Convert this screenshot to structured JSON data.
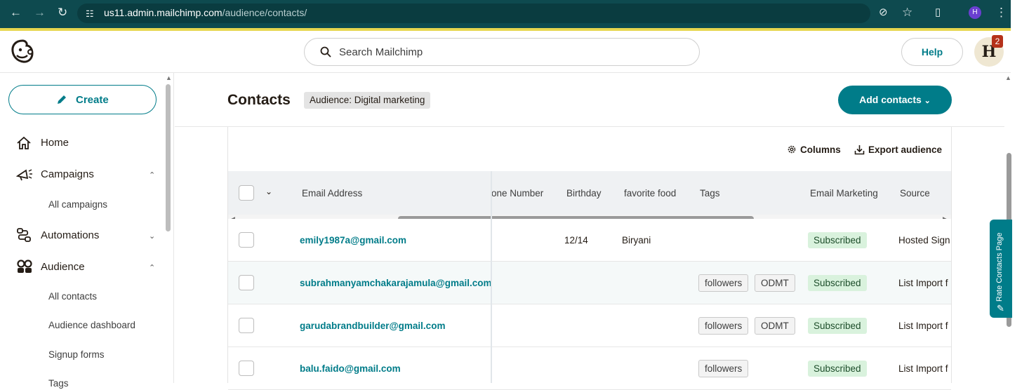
{
  "browser": {
    "url_host": "us11.admin.mailchimp.com",
    "url_path": "/audience/contacts/",
    "profile_initial": "H"
  },
  "header": {
    "search_placeholder": "Search Mailchimp",
    "help_label": "Help",
    "avatar_initial": "H",
    "notification_count": "2"
  },
  "sidebar": {
    "create_label": "Create",
    "home_label": "Home",
    "campaigns_label": "Campaigns",
    "all_campaigns_label": "All campaigns",
    "automations_label": "Automations",
    "audience_label": "Audience",
    "audience_items": [
      "All contacts",
      "Audience dashboard",
      "Signup forms",
      "Tags"
    ]
  },
  "page": {
    "title": "Contacts",
    "audience_badge": "Audience: Digital marketing",
    "add_contacts_label": "Add contacts",
    "columns_label": "Columns",
    "export_label": "Export audience",
    "rate_tab_label": "Rate Contacts Page"
  },
  "table": {
    "headers": [
      "Email Address",
      "one Number",
      "Birthday",
      "favorite food",
      "Tags",
      "Email Marketing",
      "Source"
    ],
    "rows": [
      {
        "email": "emily1987a@gmail.com",
        "birthday": "12/14",
        "food": "Biryani",
        "tags": [],
        "status": "Subscribed",
        "source": "Hosted Sign"
      },
      {
        "email": "subrahmanyamchakarajamula@gmail.com",
        "birthday": "",
        "food": "",
        "tags": [
          "followers",
          "ODMT"
        ],
        "status": "Subscribed",
        "source": "List Import f"
      },
      {
        "email": "garudabrandbuilder@gmail.com",
        "birthday": "",
        "food": "",
        "tags": [
          "followers",
          "ODMT"
        ],
        "status": "Subscribed",
        "source": "List Import f"
      },
      {
        "email": "balu.faido@gmail.com",
        "birthday": "",
        "food": "",
        "tags": [
          "followers"
        ],
        "status": "Subscribed",
        "source": "List Import f"
      }
    ]
  },
  "colors": {
    "brand_teal": "#007c89",
    "chrome_bg": "#0e4a4f",
    "subscribed_bg": "#d9f2dd"
  }
}
